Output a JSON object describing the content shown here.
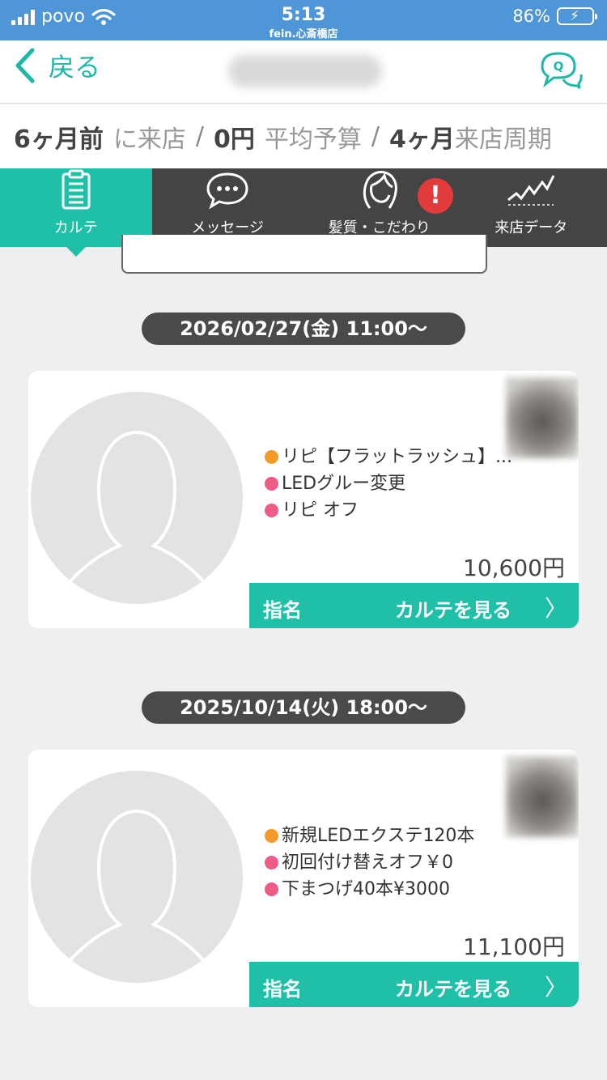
{
  "status": {
    "carrier": "povo",
    "time": "5:13",
    "shop": "fein.心斎橋店",
    "battery": "86%",
    "battery_level": 0.86,
    "colors": {
      "bar": "#4e96d7",
      "battery": "#8fd14f"
    }
  },
  "header": {
    "back_label": "戻る",
    "back_icon": "chevron-left-icon",
    "chat_icon": "chat-search-icon"
  },
  "summary": {
    "last_visit_value": "6ヶ月前",
    "last_visit_label": "に来店",
    "sep": "/",
    "budget_value": "0円",
    "budget_label": "平均予算",
    "cycle_value": "4ヶ月",
    "cycle_label": "来店周期"
  },
  "tabs": [
    {
      "label": "カルテ",
      "icon": "clipboard-icon",
      "active": true
    },
    {
      "label": "メッセージ",
      "icon": "speech-bubble-icon",
      "active": false
    },
    {
      "label": "髪質・こだわり",
      "icon": "hair-profile-icon",
      "active": false
    },
    {
      "label": "来店データ",
      "icon": "line-chart-icon",
      "active": false
    }
  ],
  "alert": {
    "text": "!"
  },
  "colors": {
    "accent": "#1fbfa8",
    "tabbar": "#444444",
    "alert": "#e23b3b",
    "dark_pill": "#4a4a4a"
  },
  "visits": [
    {
      "date": "2026/02/27(金) 11:00〜",
      "items": [
        {
          "color": "orange",
          "text": "リピ【フラットラッシュ】..."
        },
        {
          "color": "pink",
          "text": "LEDグルー変更"
        },
        {
          "color": "pink",
          "text": "リピ オフ"
        }
      ],
      "price": "10,600円",
      "nomination": "指名",
      "action_label": "カルテを見る",
      "arrow": "〉"
    },
    {
      "date": "2025/10/14(火) 18:00〜",
      "items": [
        {
          "color": "orange",
          "text": "新規LEDエクステ120本"
        },
        {
          "color": "pink",
          "text": "初回付け替えオフ￥0"
        },
        {
          "color": "pink",
          "text": "下まつげ40本¥3000"
        }
      ],
      "price": "11,100円",
      "nomination": "指名",
      "action_label": "カルテを見る",
      "arrow": "〉"
    }
  ]
}
